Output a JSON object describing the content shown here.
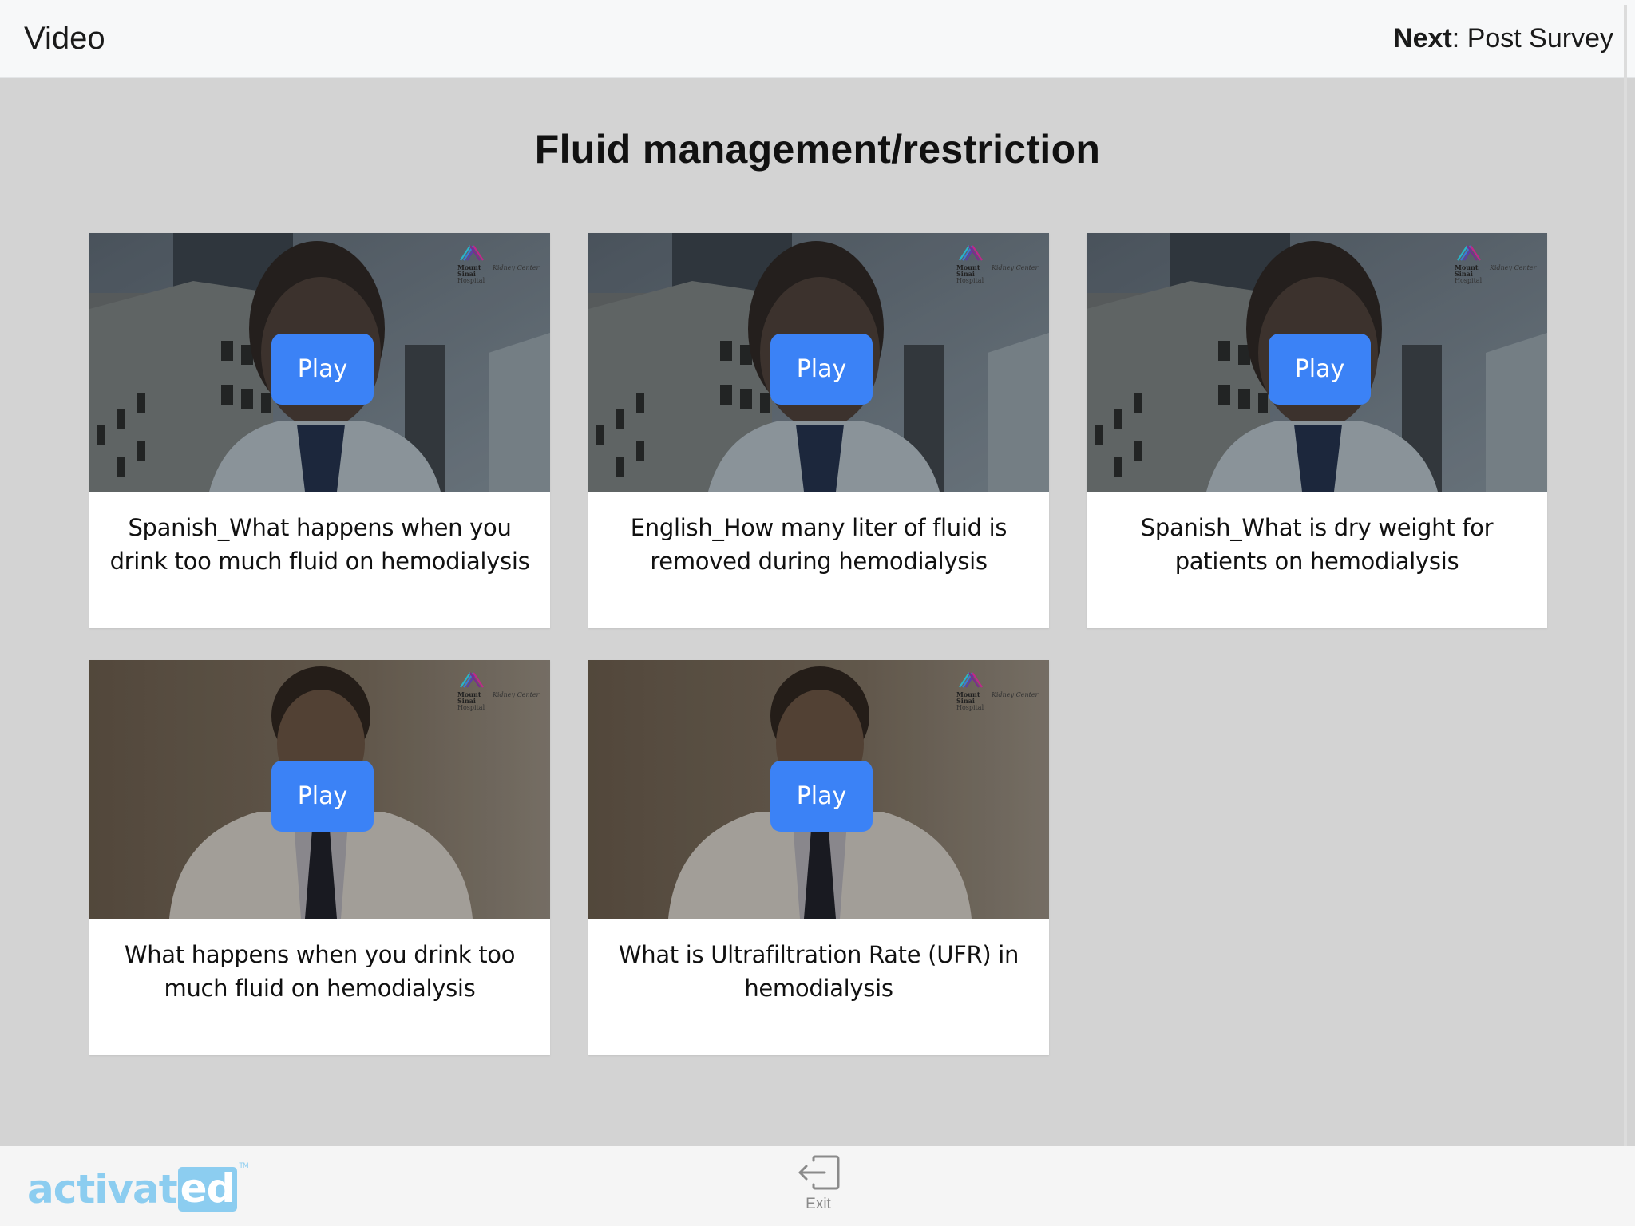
{
  "header": {
    "title": "Video",
    "next_prefix": "Next",
    "next_separator": ": ",
    "next_target": "Post Survey"
  },
  "page": {
    "heading": "Fluid management/restriction"
  },
  "videos": [
    {
      "caption": "Spanish_What happens when you drink too much fluid on hemodialysis",
      "play_label": "Play",
      "thumbnail": "doctor-building-background",
      "overlay_logo": "Mount Sinai Hospital Kidney Center"
    },
    {
      "caption": "English_How many liter of fluid is removed during hemodialysis",
      "play_label": "Play",
      "thumbnail": "doctor-building-background",
      "overlay_logo": "Mount Sinai Hospital Kidney Center"
    },
    {
      "caption": "Spanish_What is dry weight for patients on hemodialysis",
      "play_label": "Play",
      "thumbnail": "doctor-building-background",
      "overlay_logo": "Mount Sinai Hospital Kidney Center"
    },
    {
      "caption": "What happens when you drink too much fluid on hemodialysis",
      "play_label": "Play",
      "thumbnail": "doctor-plain-wall",
      "overlay_logo": "Mount Sinai Hospital Kidney Center"
    },
    {
      "caption": "What is Ultrafiltration Rate (UFR) in hemodialysis",
      "play_label": "Play",
      "thumbnail": "doctor-plain-wall",
      "overlay_logo": "Mount Sinai Hospital Kidney Center"
    }
  ],
  "thumbnail_logo": {
    "line1": "Mount",
    "line2": "Sinai",
    "line3": "Hospital",
    "side": "Kidney Center"
  },
  "footer": {
    "logo_plain": "activat",
    "logo_boxed": "ed",
    "logo_tm": "TM",
    "exit_label": "Exit",
    "exit_icon": "exit-arrow-icon"
  },
  "colors": {
    "play_button": "#3b82f6",
    "logo": "#8ccdf0",
    "content_background": "#d3d3d3",
    "header_background": "#f7f8f9"
  }
}
